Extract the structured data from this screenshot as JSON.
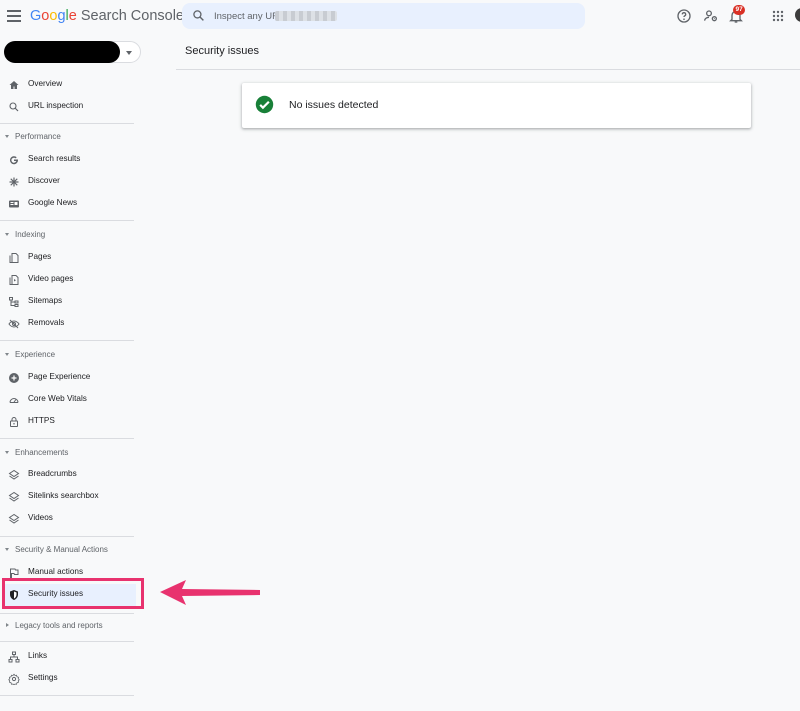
{
  "app": {
    "logo_letters": [
      "G",
      "o",
      "o",
      "g",
      "l",
      "e"
    ],
    "logo_rest": "Search Console"
  },
  "search": {
    "placeholder": "Inspect any URL in \""
  },
  "topbar": {
    "notification_count": "97",
    "icons": [
      "help-icon",
      "manage-users-icon",
      "notifications-icon",
      "apps-grid-icon"
    ]
  },
  "sidebar": {
    "overview": "Overview",
    "url_inspection": "URL inspection",
    "performance": "Performance",
    "search_results": "Search results",
    "discover": "Discover",
    "google_news": "Google News",
    "indexing": "Indexing",
    "pages": "Pages",
    "video_pages": "Video pages",
    "sitemaps": "Sitemaps",
    "removals": "Removals",
    "experience": "Experience",
    "page_experience": "Page Experience",
    "core_web_vitals": "Core Web Vitals",
    "https": "HTTPS",
    "enhancements": "Enhancements",
    "breadcrumbs": "Breadcrumbs",
    "sitelinks_searchbox": "Sitelinks searchbox",
    "videos": "Videos",
    "security_manual": "Security & Manual Actions",
    "manual_actions": "Manual actions",
    "security_issues": "Security issues",
    "legacy": "Legacy tools and reports",
    "links": "Links",
    "settings": "Settings"
  },
  "main": {
    "title": "Security issues",
    "status_message": "No issues detected"
  },
  "colors": {
    "accent": "#1a73e8",
    "active_bg": "#e8f0fe",
    "success": "#188038",
    "highlight": "#e8326e"
  }
}
